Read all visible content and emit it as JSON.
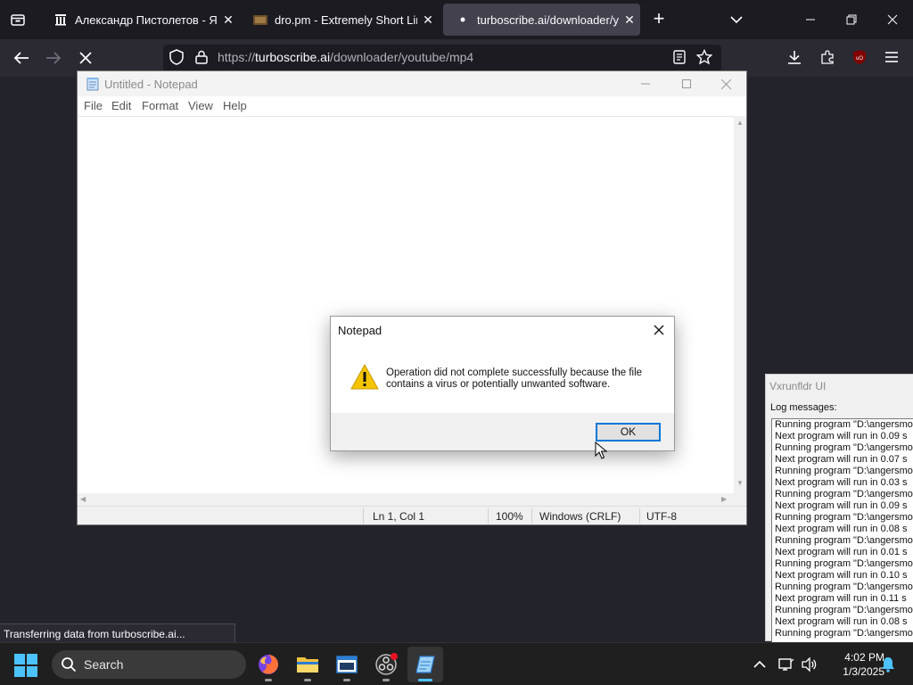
{
  "browser": {
    "tabs": [
      {
        "label": "Александр Пистолетов - Я рос"
      },
      {
        "label": "dro.pm - Extremely Short Links"
      },
      {
        "label": "turboscribe.ai/downloader/you"
      }
    ],
    "url_scheme": "https://",
    "url_host": "turboscribe.ai",
    "url_path": "/downloader/youtube/mp4",
    "status_text": "Transferring data from turboscribe.ai..."
  },
  "notepad": {
    "title": "Untitled - Notepad",
    "menu": [
      "File",
      "Edit",
      "Format",
      "View",
      "Help"
    ],
    "status": {
      "position": "Ln 1, Col 1",
      "zoom": "100%",
      "line_ending": "Windows (CRLF)",
      "encoding": "UTF-8"
    }
  },
  "dialog": {
    "title": "Notepad",
    "message": "Operation did not complete successfully because the file contains a virus or potentially unwanted software.",
    "ok_label": "OK"
  },
  "log_window": {
    "title": "Vxrunfldr UI",
    "label": "Log messages:",
    "lines": [
      "Running program \"D:\\angersmor",
      "Next program will run in 0.09 s",
      "Running program \"D:\\angersmor",
      "Next program will run in 0.07 s",
      "Running program \"D:\\angersmor",
      "Next program will run in 0.03 s",
      "Running program \"D:\\angersmor",
      "Next program will run in 0.09 s",
      "Running program \"D:\\angersmor",
      "Next program will run in 0.08 s",
      "Running program \"D:\\angersmor",
      "Next program will run in 0.01 s",
      "Running program \"D:\\angersmor",
      "Next program will run in 0.10 s",
      "Running program \"D:\\angersmor",
      "Next program will run in 0.11 s",
      "Running program \"D:\\angersmor",
      "Next program will run in 0.08 s",
      "Running program \"D:\\angersmor"
    ]
  },
  "taskbar": {
    "search_label": "Search",
    "time": "4:02 PM",
    "date": "1/3/2025"
  },
  "colors": {
    "tab_active": "#42414d",
    "accent": "#0078d7",
    "warning": "#f5c400"
  }
}
